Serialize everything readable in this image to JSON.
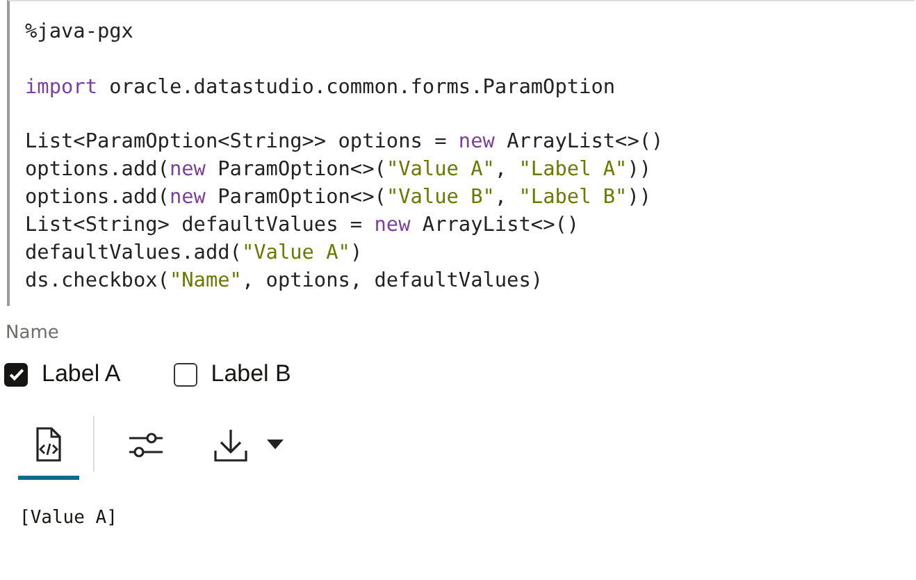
{
  "code": {
    "blocks": [
      [
        [
          {
            "kind": "plain",
            "text": "%java-pgx"
          }
        ]
      ],
      [
        [
          {
            "kind": "keyword",
            "text": "import"
          },
          {
            "kind": "plain",
            "text": " oracle.datastudio.common.forms.ParamOption"
          }
        ]
      ],
      [
        [
          {
            "kind": "plain",
            "text": "List<ParamOption<String>> options = "
          },
          {
            "kind": "keyword",
            "text": "new"
          },
          {
            "kind": "plain",
            "text": " ArrayList<>()"
          }
        ],
        [
          {
            "kind": "plain",
            "text": "options.add("
          },
          {
            "kind": "keyword",
            "text": "new"
          },
          {
            "kind": "plain",
            "text": " ParamOption<>("
          },
          {
            "kind": "string",
            "text": "\"Value A\""
          },
          {
            "kind": "plain",
            "text": ", "
          },
          {
            "kind": "string",
            "text": "\"Label A\""
          },
          {
            "kind": "plain",
            "text": "))"
          }
        ],
        [
          {
            "kind": "plain",
            "text": "options.add("
          },
          {
            "kind": "keyword",
            "text": "new"
          },
          {
            "kind": "plain",
            "text": " ParamOption<>("
          },
          {
            "kind": "string",
            "text": "\"Value B\""
          },
          {
            "kind": "plain",
            "text": ", "
          },
          {
            "kind": "string",
            "text": "\"Label B\""
          },
          {
            "kind": "plain",
            "text": "))"
          }
        ],
        [
          {
            "kind": "plain",
            "text": "List<String> defaultValues = "
          },
          {
            "kind": "keyword",
            "text": "new"
          },
          {
            "kind": "plain",
            "text": " ArrayList<>()"
          }
        ],
        [
          {
            "kind": "plain",
            "text": "defaultValues.add("
          },
          {
            "kind": "string",
            "text": "\"Value A\""
          },
          {
            "kind": "plain",
            "text": ")"
          }
        ],
        [
          {
            "kind": "plain",
            "text": "ds.checkbox("
          },
          {
            "kind": "string",
            "text": "\"Name\""
          },
          {
            "kind": "plain",
            "text": ", options, defaultValues)"
          }
        ]
      ]
    ]
  },
  "form": {
    "label": "Name",
    "options": [
      {
        "label": "Label A",
        "checked": true
      },
      {
        "label": "Label B",
        "checked": false
      }
    ]
  },
  "toolbar": [
    {
      "kind": "code",
      "selected": true
    },
    {
      "kind": "settings",
      "selected": false
    },
    {
      "kind": "download",
      "selected": false
    }
  ],
  "output": "[Value A]"
}
